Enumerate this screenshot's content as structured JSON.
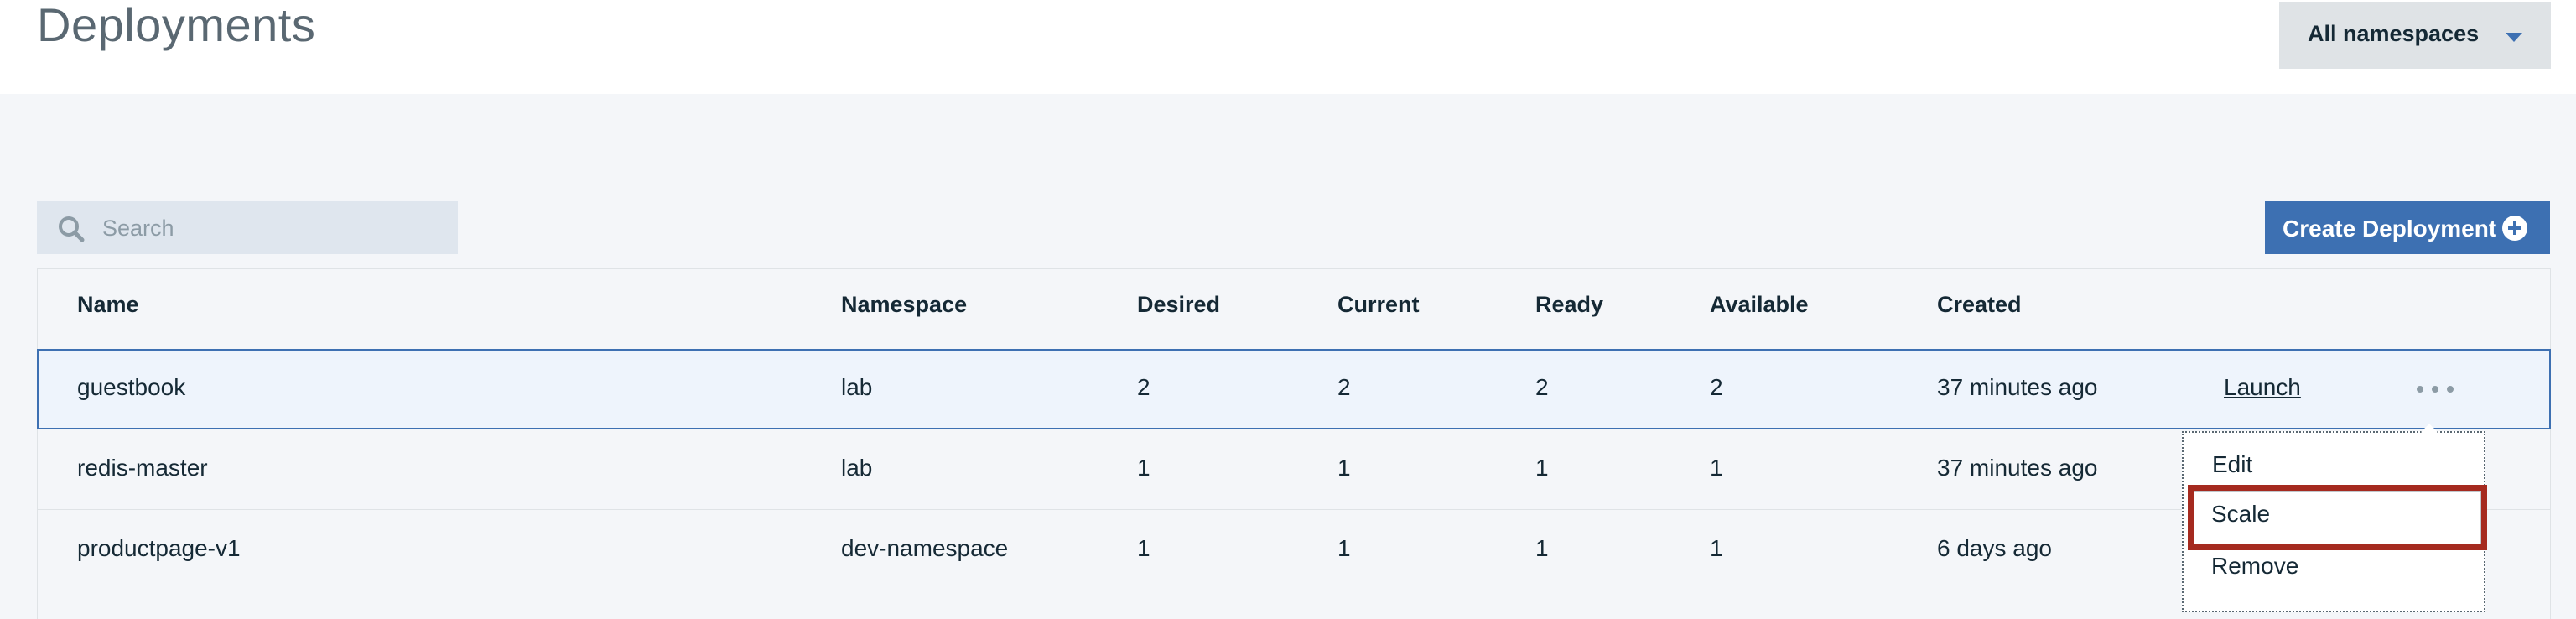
{
  "header": {
    "title": "Deployments",
    "namespace_select": {
      "selected": "All namespaces"
    }
  },
  "toolbar": {
    "search": {
      "placeholder": "Search",
      "value": ""
    },
    "create_label": "Create Deployment"
  },
  "table": {
    "columns": [
      "Name",
      "Namespace",
      "Desired",
      "Current",
      "Ready",
      "Available",
      "Created"
    ],
    "rows": [
      {
        "name": "guestbook",
        "namespace": "lab",
        "desired": "2",
        "current": "2",
        "ready": "2",
        "available": "2",
        "created": "37 minutes ago",
        "action": "Launch"
      },
      {
        "name": "redis-master",
        "namespace": "lab",
        "desired": "1",
        "current": "1",
        "ready": "1",
        "available": "1",
        "created": "37 minutes ago"
      },
      {
        "name": "productpage-v1",
        "namespace": "dev-namespace",
        "desired": "1",
        "current": "1",
        "ready": "1",
        "available": "1",
        "created": "6 days ago"
      }
    ]
  },
  "menu": {
    "items": [
      "Edit",
      "Scale",
      "Remove"
    ]
  },
  "icons": {
    "search": "search-icon",
    "caret": "caret-down-icon",
    "add": "add-circle-icon",
    "overflow": "overflow-menu-icon"
  },
  "colors": {
    "accent": "#3d70b2",
    "highlight": "#a52a1f",
    "selected_row": "#eef4fc"
  }
}
